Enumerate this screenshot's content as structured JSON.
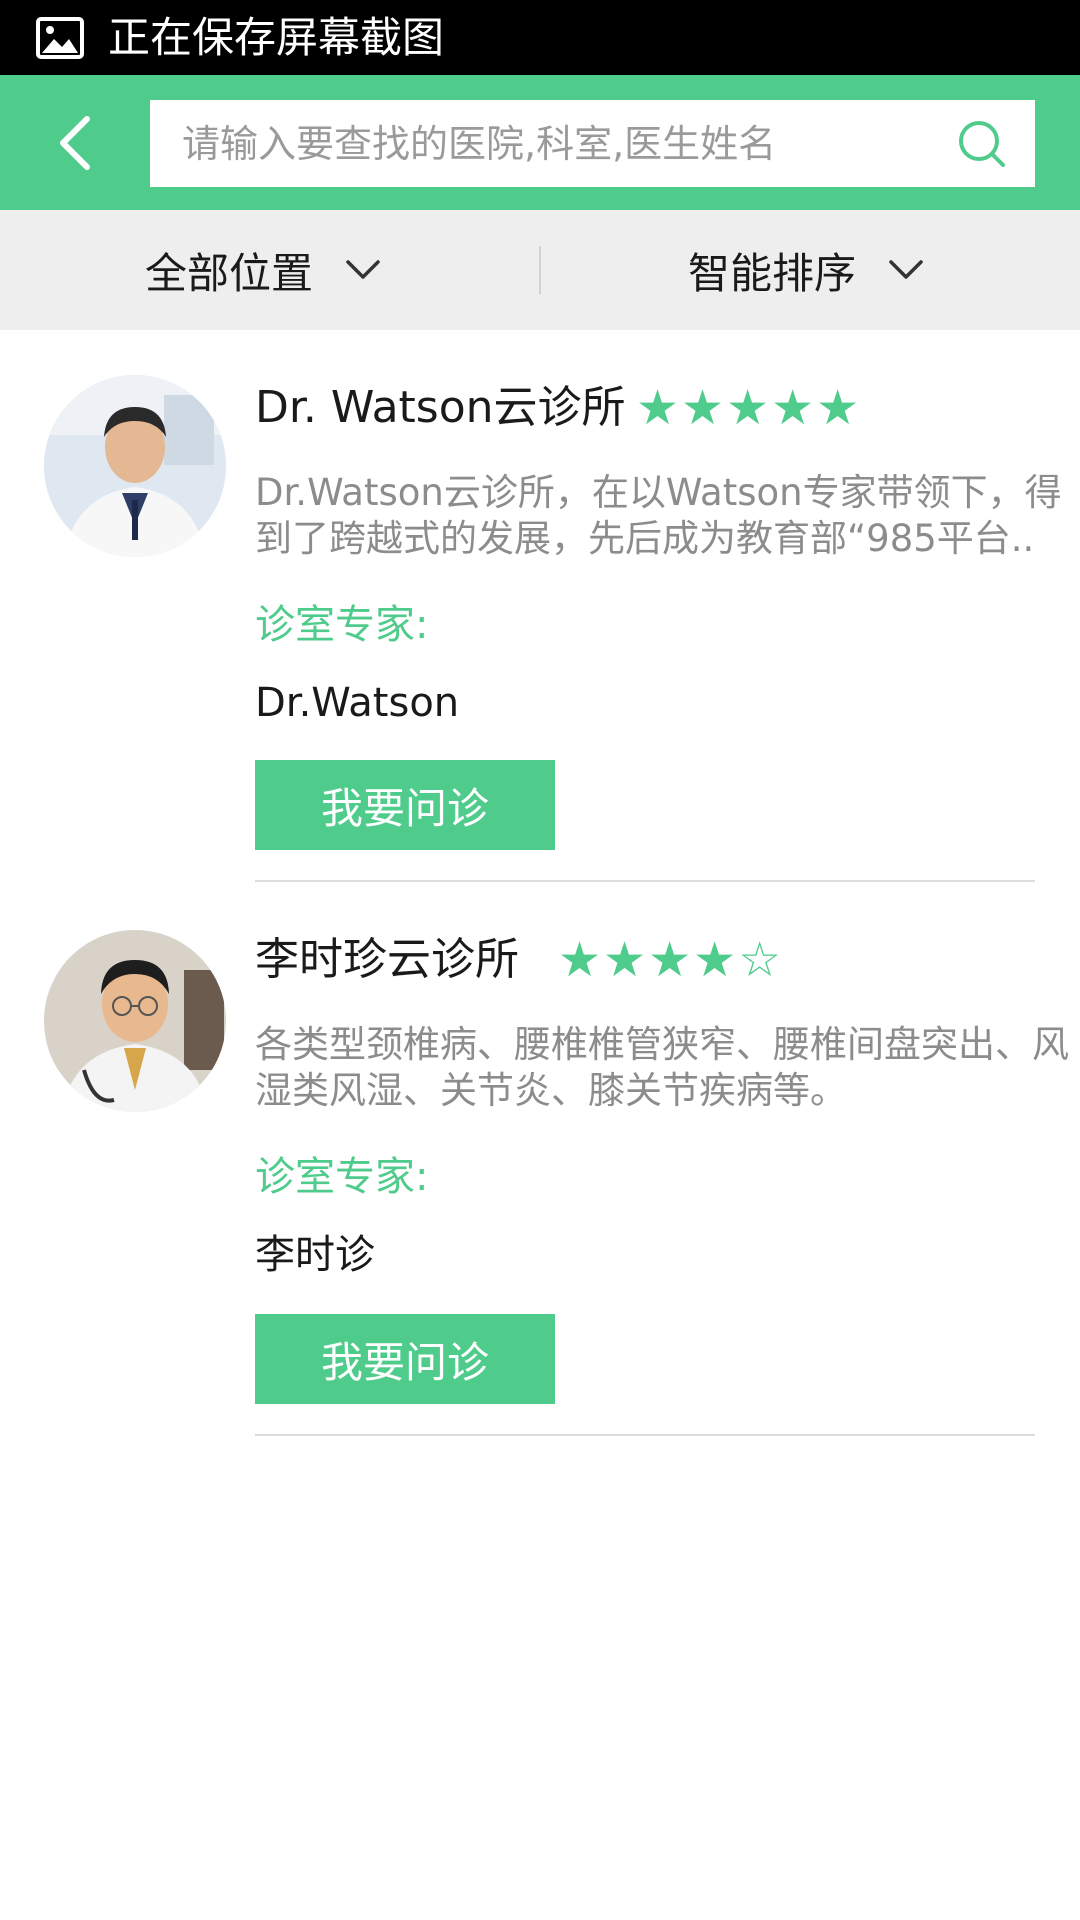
{
  "status_bar": {
    "icon": "image-icon",
    "text": "正在保存屏幕截图"
  },
  "header": {
    "back_icon": "chevron-left-icon",
    "search_placeholder": "请输入要查找的医院,科室,医生姓名",
    "search_value": "",
    "search_icon": "search-icon"
  },
  "filters": {
    "location": "全部位置",
    "sort": "智能排序"
  },
  "clinics": [
    {
      "name": "Dr. Watson云诊所",
      "stars_filled": 5,
      "stars_total": 5,
      "description": "Dr.Watson云诊所，在以Watson专家带领下，得到了跨越式的发展，先后成为教育部“985平台..",
      "expert_label": "诊室专家:",
      "expert_name": "Dr.Watson",
      "button_label": "我要问诊"
    },
    {
      "name": "李时珍云诊所",
      "stars_filled": 4,
      "stars_total": 5,
      "description": "各类型颈椎病、腰椎椎管狭窄、腰椎间盘突出、风湿类风湿、关节炎、膝关节疾病等。",
      "expert_label": "诊室专家:",
      "expert_name": "李时诊",
      "button_label": "我要问诊"
    }
  ],
  "colors": {
    "brand_green": "#4fcb8b",
    "status_bar": "#000000",
    "filter_bar": "#eeeeee"
  }
}
